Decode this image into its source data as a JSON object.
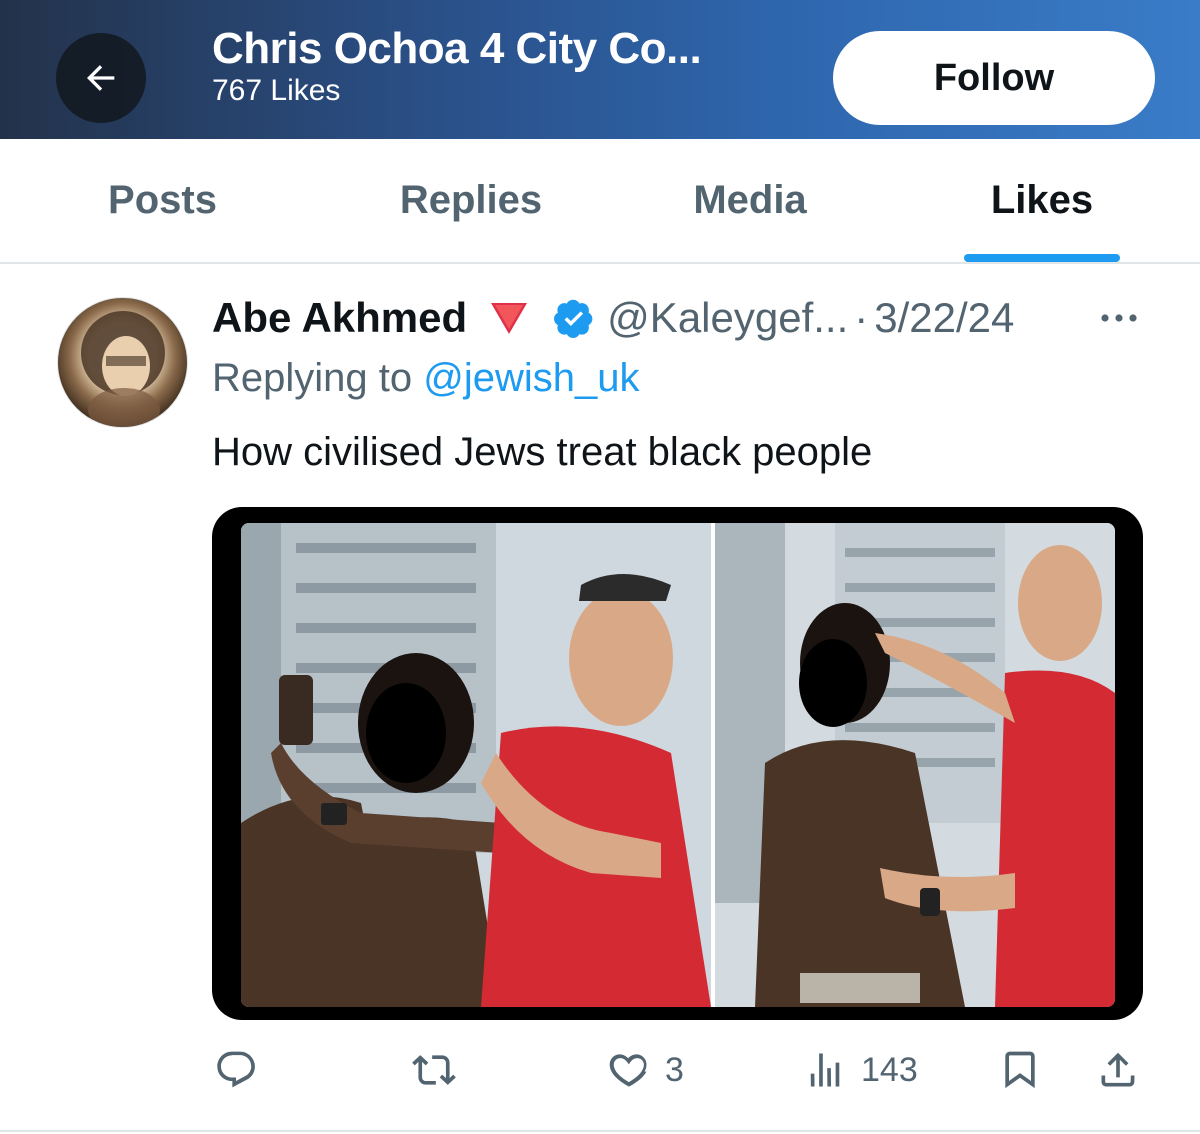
{
  "header": {
    "title": "Chris Ochoa 4 City Co...",
    "subtitle": "767 Likes",
    "follow_label": "Follow"
  },
  "tabs": [
    {
      "label": "Posts"
    },
    {
      "label": "Replies"
    },
    {
      "label": "Media"
    },
    {
      "label": "Likes",
      "active": true
    }
  ],
  "tweet": {
    "author_name": "Abe Akhmed",
    "handle": "@Kaleygef...",
    "separator": "·",
    "date": "3/22/24",
    "replying_prefix": "Replying to ",
    "replying_to": "@jewish_uk",
    "text": "How civilised Jews treat black people",
    "icons": {
      "emoji": "red-triangle-icon",
      "verified": "verified-badge-icon",
      "more": "more-icon"
    },
    "actions": {
      "reply_count": "",
      "retweet_count": "",
      "like_count": "3",
      "views_count": "143"
    }
  },
  "colors": {
    "accent": "#1d9bf0",
    "text_primary": "#0f1419",
    "text_secondary": "#536471"
  }
}
